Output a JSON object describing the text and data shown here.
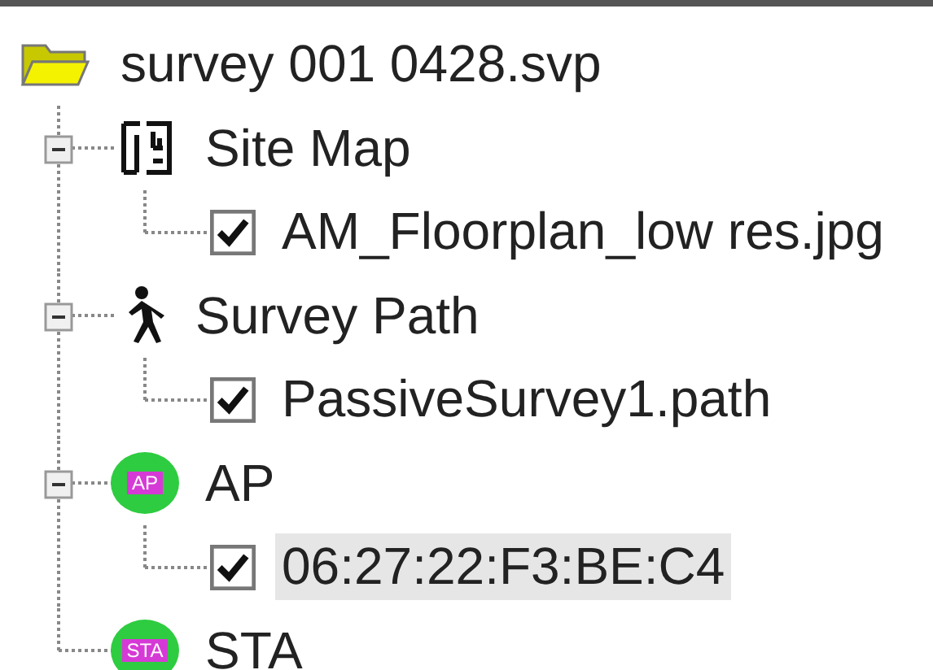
{
  "tree": {
    "label": "survey 001 0428.svp",
    "expanded": true,
    "children": [
      {
        "label": "Site Map",
        "kind": "sitemap",
        "expanded": true,
        "children": [
          {
            "label": "AM_Floorplan_low res.jpg",
            "checked": true,
            "selected": false
          }
        ]
      },
      {
        "label": "Survey Path",
        "kind": "walker",
        "expanded": true,
        "children": [
          {
            "label": "PassiveSurvey1.path",
            "checked": true,
            "selected": false
          }
        ]
      },
      {
        "label": "AP",
        "kind": "badge",
        "icon_label": "AP",
        "expanded": true,
        "children": [
          {
            "label": "06:27:22:F3:BE:C4",
            "checked": true,
            "selected": true
          }
        ]
      },
      {
        "label": "STA",
        "kind": "badge",
        "icon_label": "STA"
      }
    ]
  }
}
